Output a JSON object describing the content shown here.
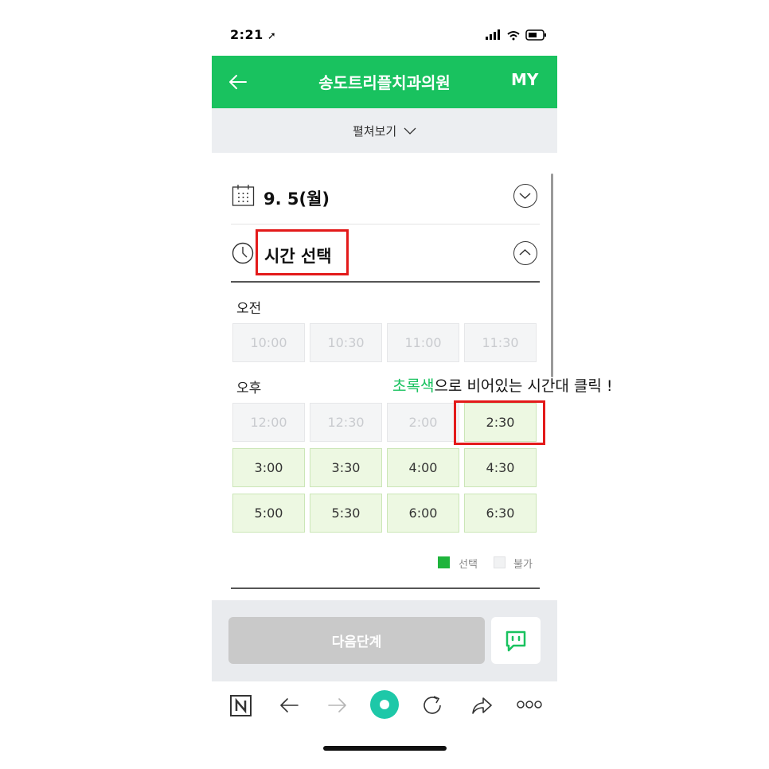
{
  "status_bar": {
    "time": "2:21"
  },
  "header": {
    "title": "송도트리플치과의원",
    "my_label": "MY"
  },
  "expand": {
    "label": "펼쳐보기"
  },
  "date_row": {
    "date": "9. 5(월)"
  },
  "time_row": {
    "title": "시간 선택"
  },
  "morning": {
    "label": "오전",
    "slots": [
      {
        "time": "10:00",
        "available": false
      },
      {
        "time": "10:30",
        "available": false
      },
      {
        "time": "11:00",
        "available": false
      },
      {
        "time": "11:30",
        "available": false
      }
    ]
  },
  "afternoon": {
    "label": "오후",
    "slots": [
      {
        "time": "12:00",
        "available": false
      },
      {
        "time": "12:30",
        "available": false
      },
      {
        "time": "2:00",
        "available": false
      },
      {
        "time": "2:30",
        "available": true
      },
      {
        "time": "3:00",
        "available": true
      },
      {
        "time": "3:30",
        "available": true
      },
      {
        "time": "4:00",
        "available": true
      },
      {
        "time": "4:30",
        "available": true
      },
      {
        "time": "5:00",
        "available": true
      },
      {
        "time": "5:30",
        "available": true
      },
      {
        "time": "6:00",
        "available": true
      },
      {
        "time": "6:30",
        "available": true
      }
    ]
  },
  "annotation": {
    "highlight": "초록색",
    "rest": "으로 비어있는 시간대 클릭 !"
  },
  "legend": {
    "selected": "선택",
    "unavailable": "불가"
  },
  "actions": {
    "next_label": "다음단계"
  },
  "colors": {
    "brand_green": "#19c25f",
    "available_bg": "#edf8e2",
    "annotation_red": "#e31a1a"
  },
  "icons": [
    "back-arrow-icon",
    "chevron-down-icon",
    "calendar-icon",
    "clock-icon",
    "chevron-up-icon",
    "chat-icon",
    "naver-icon",
    "browser-back-icon",
    "browser-forward-icon",
    "home-circle-icon",
    "refresh-icon",
    "share-icon",
    "more-icon"
  ]
}
